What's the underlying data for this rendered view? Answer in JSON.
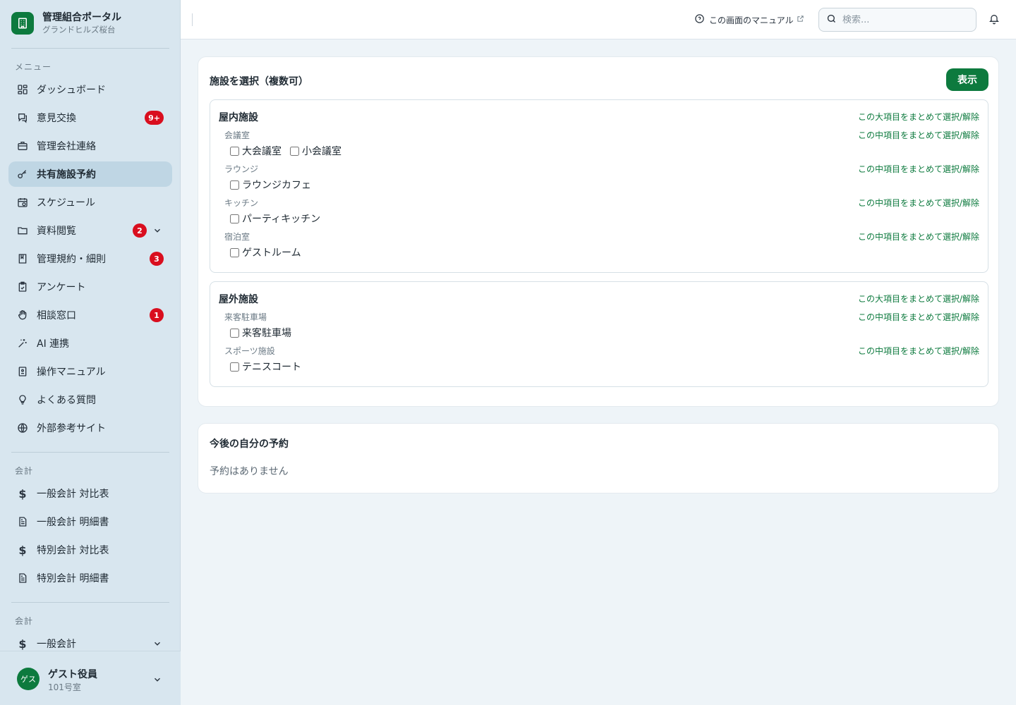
{
  "brand": {
    "title": "管理組合ポータル",
    "subtitle": "グランドヒルズ桜台"
  },
  "sidebar": {
    "menu_label": "メニュー",
    "items": [
      {
        "label": "ダッシュボード"
      },
      {
        "label": "意見交換",
        "badge": "9+"
      },
      {
        "label": "管理会社連絡"
      },
      {
        "label": "共有施設予約",
        "active": true
      },
      {
        "label": "スケジュール"
      },
      {
        "label": "資料閲覧",
        "badge": "2"
      },
      {
        "label": "管理規約・細則",
        "badge": "3"
      },
      {
        "label": "アンケート"
      },
      {
        "label": "相談窓口",
        "badge": "1"
      },
      {
        "label": "AI 連携"
      },
      {
        "label": "操作マニュアル"
      },
      {
        "label": "よくある質問"
      },
      {
        "label": "外部参考サイト"
      }
    ],
    "accounting_label": "会計",
    "accounting_items": [
      {
        "label": "一般会計 対比表"
      },
      {
        "label": "一般会計 明細書"
      },
      {
        "label": "特別会計 対比表"
      },
      {
        "label": "特別会計 明細書"
      }
    ],
    "accounting2_label": "会計",
    "accounting2_items": [
      {
        "label": "一般会計"
      }
    ]
  },
  "user": {
    "avatar": "ゲス",
    "name": "ゲスト役員",
    "room": "101号室"
  },
  "header": {
    "manual_link": "この画面のマニュアル",
    "search_placeholder": "検索..."
  },
  "facility": {
    "title": "施設を選択（複数可）",
    "show_button": "表示",
    "bulk_large": "この大項目をまとめて選択/解除",
    "bulk_medium": "この中項目をまとめて選択/解除",
    "groups": [
      {
        "name": "屋内施設",
        "subgroups": [
          {
            "name": "会議室",
            "options": [
              "大会議室",
              "小会議室"
            ]
          },
          {
            "name": "ラウンジ",
            "options": [
              "ラウンジカフェ"
            ]
          },
          {
            "name": "キッチン",
            "options": [
              "パーティキッチン"
            ]
          },
          {
            "name": "宿泊室",
            "options": [
              "ゲストルーム"
            ]
          }
        ]
      },
      {
        "name": "屋外施設",
        "subgroups": [
          {
            "name": "来客駐車場",
            "options": [
              "来客駐車場"
            ]
          },
          {
            "name": "スポーツ施設",
            "options": [
              "テニスコート"
            ]
          }
        ]
      }
    ]
  },
  "reservations": {
    "title": "今後の自分の予約",
    "empty": "予約はありません"
  },
  "colors": {
    "accent": "#0d7a3e",
    "badge": "#d90e1e",
    "sidebar_bg": "#d8e6ef",
    "page_bg": "#eef4f8"
  }
}
